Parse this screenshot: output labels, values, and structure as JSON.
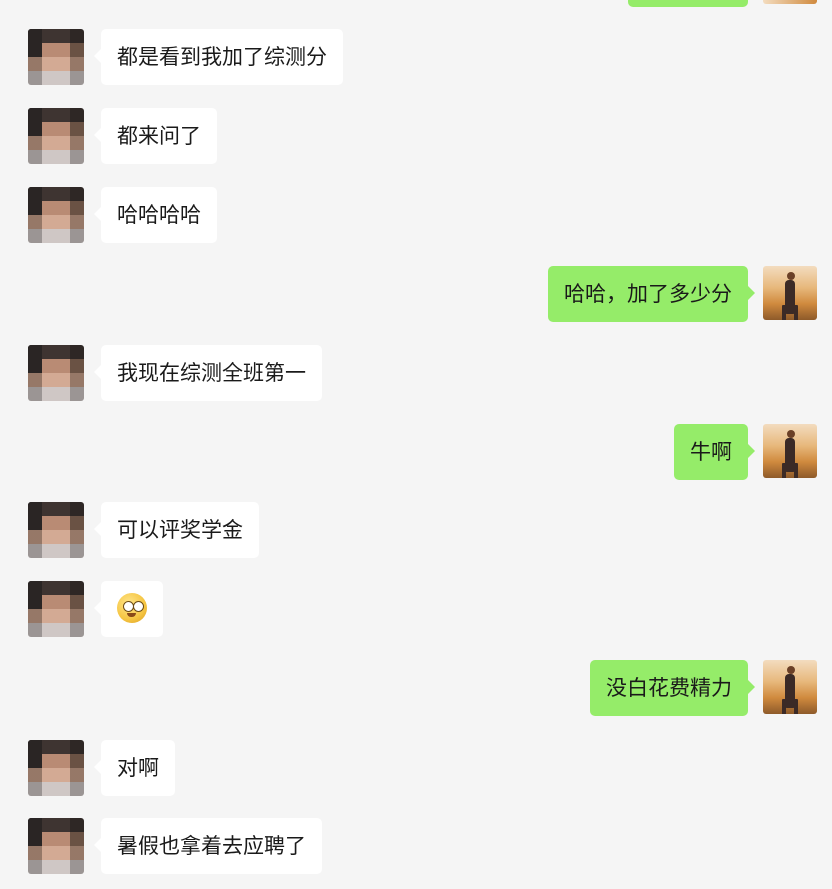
{
  "messages": [
    {
      "side": "left",
      "text": "都是看到我加了综测分"
    },
    {
      "side": "left",
      "text": "都来问了"
    },
    {
      "side": "left",
      "text": "哈哈哈哈"
    },
    {
      "side": "right",
      "text": "哈哈，加了多少分"
    },
    {
      "side": "left",
      "text": "我现在综测全班第一"
    },
    {
      "side": "right",
      "text": "牛啊"
    },
    {
      "side": "left",
      "text": "可以评奖学金"
    },
    {
      "side": "left",
      "text": "",
      "emoji": "surprised-face-emoji"
    },
    {
      "side": "right",
      "text": "没白花费精力"
    },
    {
      "side": "left",
      "text": "对啊"
    },
    {
      "side": "left",
      "text": "暑假也拿着去应聘了"
    }
  ],
  "colors": {
    "background": "#f5f5f5",
    "self_bubble": "#95ec69",
    "other_bubble": "#ffffff"
  }
}
